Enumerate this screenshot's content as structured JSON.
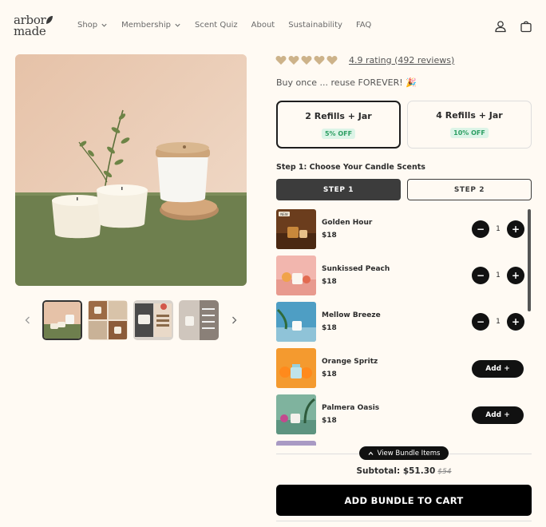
{
  "header": {
    "logo": {
      "line1": "arbor",
      "line2": "made"
    },
    "nav": [
      {
        "label": "Shop",
        "has_dropdown": true
      },
      {
        "label": "Membership",
        "has_dropdown": true
      },
      {
        "label": "Scent Quiz",
        "has_dropdown": false
      },
      {
        "label": "About",
        "has_dropdown": false
      },
      {
        "label": "Sustainability",
        "has_dropdown": false
      },
      {
        "label": "FAQ",
        "has_dropdown": false
      }
    ],
    "icons": [
      "account-icon",
      "cart-icon"
    ]
  },
  "product": {
    "rating_text": "4.9 rating (492 reviews)",
    "hearts": 5,
    "tagline": "Buy once ... reuse FOREVER! 🎉"
  },
  "bundle_options": [
    {
      "title": "2 Refills + Jar",
      "badge": "5% OFF",
      "selected": true
    },
    {
      "title": "4 Refills + Jar",
      "badge": "10% OFF",
      "selected": false
    }
  ],
  "steps": {
    "heading": "Step 1: Choose Your Candle Scents",
    "step1_label": "STEP 1",
    "step2_label": "STEP 2"
  },
  "scents": [
    {
      "name": "Golden Hour",
      "price": "$18",
      "qty": "1",
      "in_bundle": true,
      "tag": "NEW"
    },
    {
      "name": "Sunkissed Peach",
      "price": "$18",
      "qty": "1",
      "in_bundle": true
    },
    {
      "name": "Mellow Breeze",
      "price": "$18",
      "qty": "1",
      "in_bundle": true
    },
    {
      "name": "Orange Spritz",
      "price": "$18",
      "add_label": "Add +",
      "in_bundle": false
    },
    {
      "name": "Palmera Oasis",
      "price": "$18",
      "add_label": "Add +",
      "in_bundle": false
    }
  ],
  "summary": {
    "view_bundle": "View Bundle Items",
    "subtotal_label": "Subtotal: $51.30",
    "original_price": "$54",
    "cta": "ADD BUNDLE TO CART"
  },
  "colors": {
    "background": "#fffaf3",
    "badge_bg": "#dcf4e7",
    "badge_text": "#2c9e62",
    "button_dark": "#111111",
    "heart": "#cdb38a"
  }
}
